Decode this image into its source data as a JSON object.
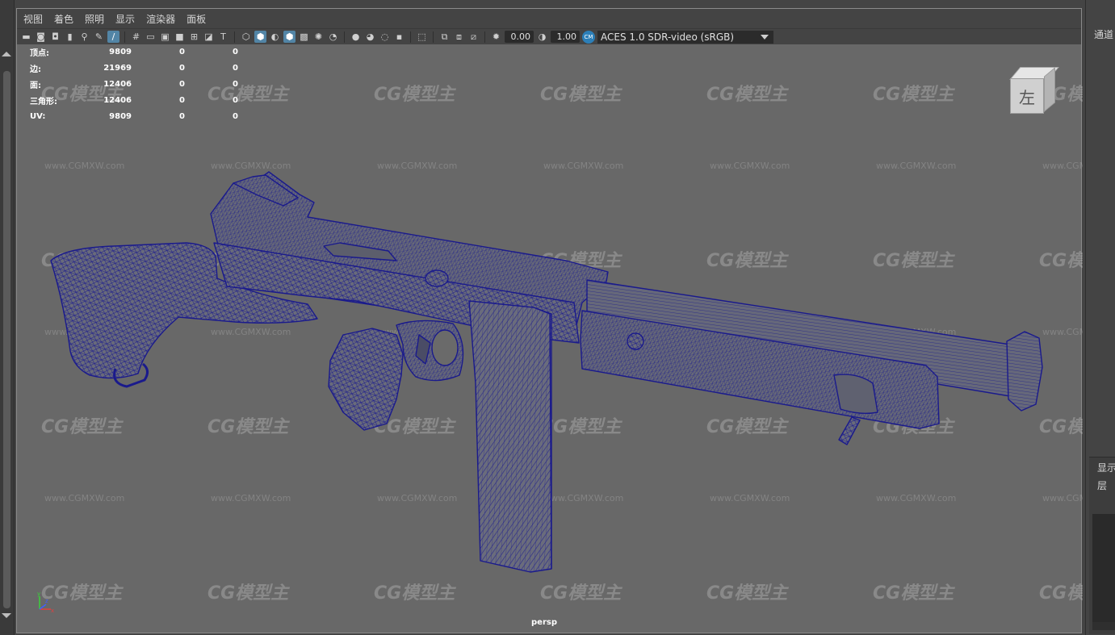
{
  "menu": {
    "items": [
      "视图",
      "着色",
      "照明",
      "显示",
      "渲染器",
      "面板"
    ]
  },
  "toolbar": {
    "exposure_value": "0.00",
    "gamma_value": "1.00",
    "color_transform": "ACES 1.0 SDR-video (sRGB)"
  },
  "hud": {
    "rows": [
      {
        "label": "顶点:",
        "v1": "9809",
        "v2": "0",
        "v3": "0"
      },
      {
        "label": "边:",
        "v1": "21969",
        "v2": "0",
        "v3": "0"
      },
      {
        "label": "面:",
        "v1": "12406",
        "v2": "0",
        "v3": "0"
      },
      {
        "label": "三角形:",
        "v1": "12406",
        "v2": "0",
        "v3": "0"
      },
      {
        "label": "UV:",
        "v1": "9809",
        "v2": "0",
        "v3": "0"
      }
    ]
  },
  "viewcube": {
    "face_label": "左"
  },
  "axis": {
    "x": "x",
    "y": "y",
    "z": "z"
  },
  "camera_label": "persp",
  "watermark": {
    "logo": "CG模型主",
    "url": "www.CGMXW.com"
  },
  "right_panel": {
    "tab_label": "通道",
    "display_label": "显示",
    "layer_label": "层"
  },
  "colors": {
    "viewport_bg": "#686868",
    "wireframe": "#1a1a8c",
    "ui_dark": "#444444",
    "active_icon": "#5285a6"
  }
}
